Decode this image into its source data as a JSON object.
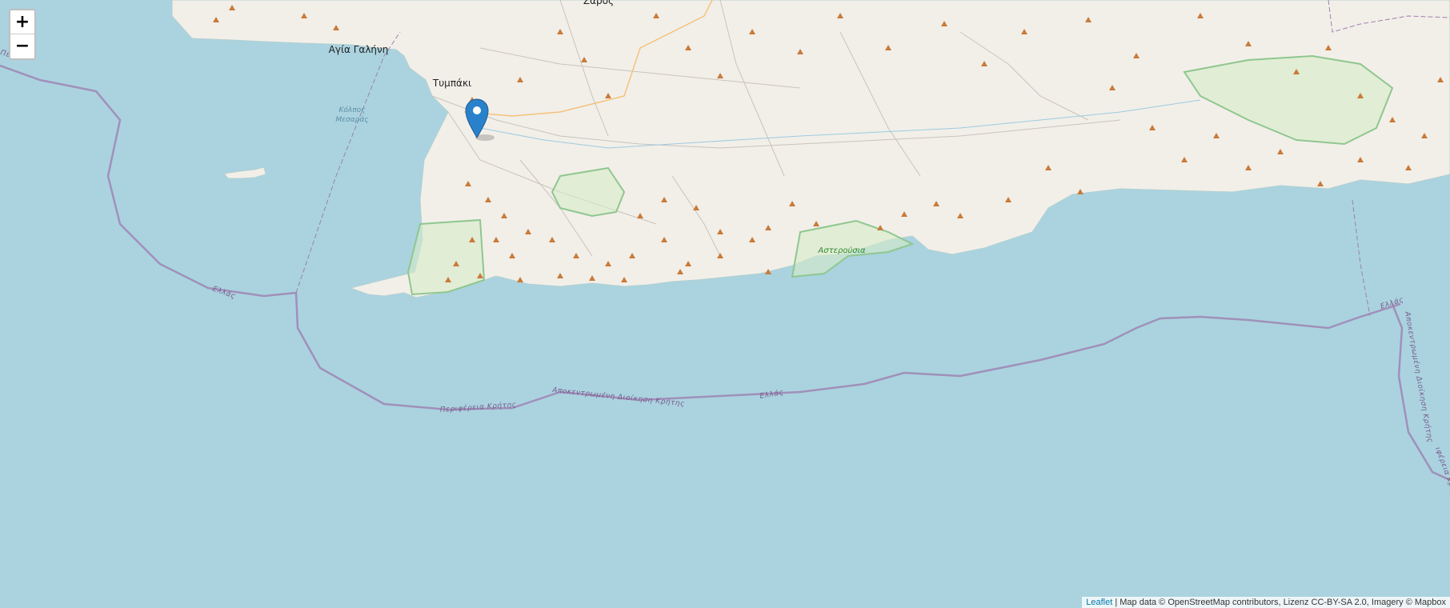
{
  "map": {
    "places": [
      {
        "id": "zaros",
        "label": "Ζαρός"
      },
      {
        "id": "agia-galini",
        "label": "Αγία Γαλήνη"
      },
      {
        "id": "tympaki",
        "label": "Τυμπάκι"
      },
      {
        "id": "asterousia",
        "label": "Αστερούσια"
      }
    ],
    "water_label_line1": "Κόλπος",
    "water_label_line2": "Μεσαράς",
    "boundary_labels": [
      {
        "id": "b1",
        "label": "Ελλάς"
      },
      {
        "id": "b2",
        "label": "Περιφέρεια Κρήτης"
      },
      {
        "id": "b3",
        "label": "Αποκεντρωμένη Διοίκηση Κρήτης"
      },
      {
        "id": "b4",
        "label": "Ελλάς"
      },
      {
        "id": "b5",
        "label": "Ελλάς"
      },
      {
        "id": "b6",
        "label": "Αποκεντρωμένη Διοίκηση Κρήτης"
      },
      {
        "id": "b7",
        "label": "ιφέρεια Κρήτης"
      },
      {
        "id": "b8",
        "label": "Περ"
      }
    ],
    "colors": {
      "sea": "#aad3df",
      "land": "#f2efe9",
      "boundary": "#9e7fb0",
      "park": "#8fc78f",
      "peak": "#c97a3a",
      "marker": "#2a81cb"
    }
  },
  "controls": {
    "zoom_in": "+",
    "zoom_out": "−"
  },
  "attribution": {
    "leaflet": "Leaflet",
    "text": " | Map data © OpenStreetMap contributors, Lizenz CC-BY-SA 2.0, Imagery © Mapbox"
  }
}
